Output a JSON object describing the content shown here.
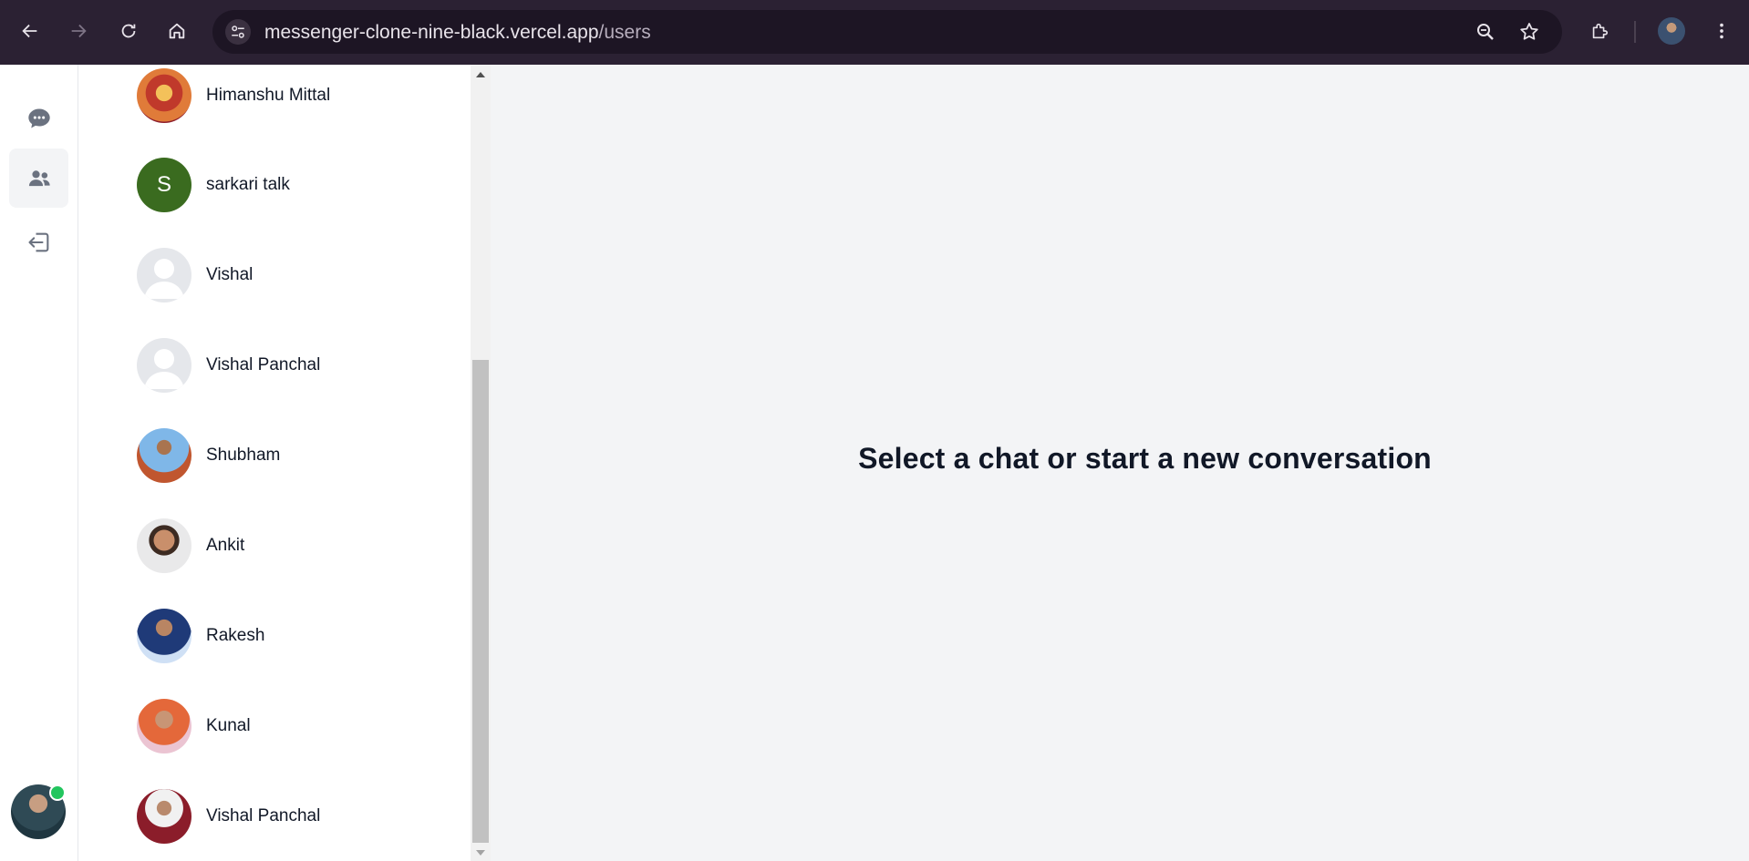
{
  "browser": {
    "url_host": "messenger-clone-nine-black.vercel.app",
    "url_path": "/users"
  },
  "sidebar": {
    "items": [
      {
        "name": "conversations",
        "icon": "chat-bubble-icon",
        "active": false
      },
      {
        "name": "users",
        "icon": "users-icon",
        "active": true
      },
      {
        "name": "logout",
        "icon": "logout-icon",
        "active": false
      }
    ],
    "online_color": "#22c55e"
  },
  "users": [
    {
      "name": "Himanshu Mittal",
      "avatar": "photo"
    },
    {
      "name": "sarkari talk",
      "avatar": "letter",
      "letter": "S",
      "color": "#3a6b1f"
    },
    {
      "name": "Vishal",
      "avatar": "default"
    },
    {
      "name": "Vishal Panchal",
      "avatar": "default"
    },
    {
      "name": "Shubham",
      "avatar": "photo"
    },
    {
      "name": "Ankit",
      "avatar": "photo"
    },
    {
      "name": "Rakesh",
      "avatar": "photo"
    },
    {
      "name": "Kunal",
      "avatar": "photo"
    },
    {
      "name": "Vishal Panchal",
      "avatar": "photo"
    }
  ],
  "main": {
    "empty_state": "Select a chat or start a new conversation"
  }
}
